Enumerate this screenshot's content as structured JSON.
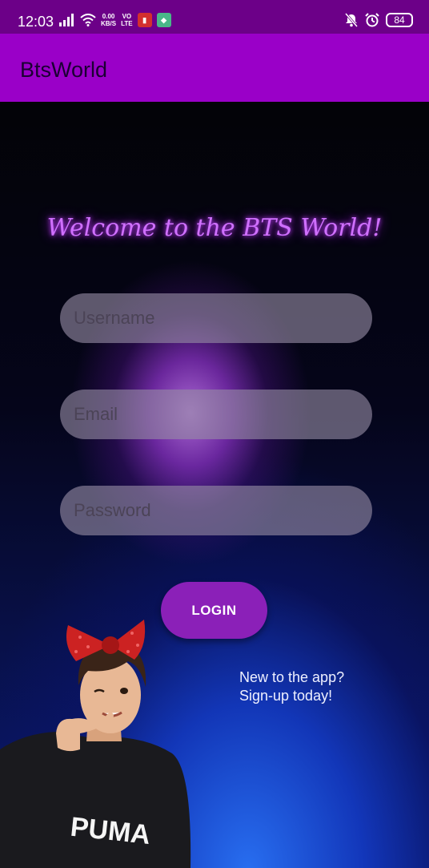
{
  "status_bar": {
    "time": "12:03",
    "net_speed_value": "0.00",
    "net_speed_unit": "KB/S",
    "volte_top": "VO",
    "volte_bottom": "LTE",
    "battery": "84"
  },
  "app_bar": {
    "title": "BtsWorld"
  },
  "welcome_text": "Welcome to the BTS World!",
  "form": {
    "username_placeholder": "Username",
    "email_placeholder": "Email",
    "password_placeholder": "Password",
    "login_label": "LOGIN",
    "signup_line1": "New to the app?",
    "signup_line2": "Sign-up today!"
  },
  "photo_print": "PUMA",
  "colors": {
    "status_bar": "#6c0088",
    "app_bar": "#9a00c8",
    "login_button": "#8b20b8",
    "welcome_glow": "#d070ff"
  },
  "icons": [
    "signal-icon",
    "wifi-icon",
    "mute-icon",
    "alarm-icon",
    "battery-icon"
  ]
}
